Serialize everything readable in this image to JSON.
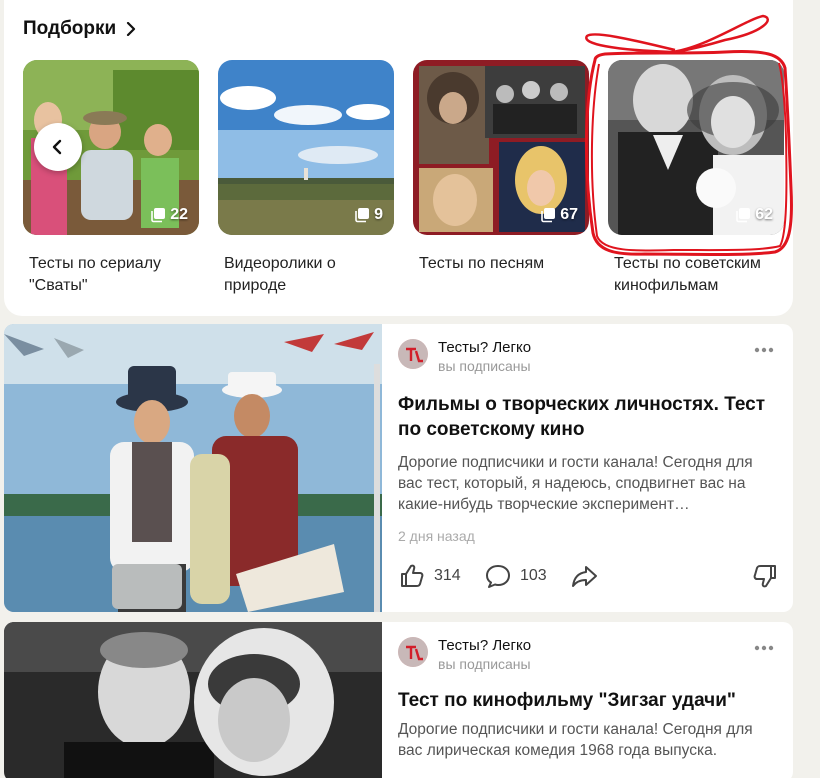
{
  "collections": {
    "title": "Подборки",
    "items": [
      {
        "label": "Тесты по сериалу \"Сваты\"",
        "count": "22"
      },
      {
        "label": "Видеоролики о природе",
        "count": "9"
      },
      {
        "label": "Тесты по песням",
        "count": "67"
      },
      {
        "label": "Тесты по советским кинофильмам",
        "count": "62"
      }
    ]
  },
  "posts": [
    {
      "author": "Тесты? Легко",
      "subscription": "вы подписаны",
      "title": "Фильмы о творческих личностях. Тест по советскому кино",
      "description": "Дорогие подписчики и гости канала! Сегодня для вас тест, который, я надеюсь, сподвигнет вас на какие-нибудь творческие эксперимент…",
      "date": "2 дня назад",
      "likes": "314",
      "comments": "103"
    },
    {
      "author": "Тесты? Легко",
      "subscription": "вы подписаны",
      "title": "Тест по кинофильму \"Зигзаг удачи\"",
      "description": "Дорогие подписчики и гости канала! Сегодня для вас лирическая комедия 1968 года выпуска."
    }
  ],
  "colors": {
    "annotation": "#e0141e",
    "muted_text": "#999999"
  }
}
